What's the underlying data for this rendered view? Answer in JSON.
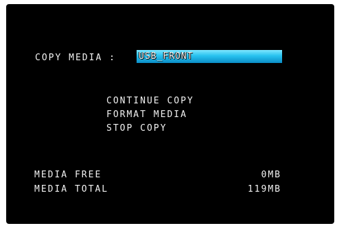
{
  "copy_media": {
    "label": "COPY MEDIA :",
    "value": "USB_FRONT"
  },
  "menu": {
    "items": [
      {
        "label": "CONTINUE COPY"
      },
      {
        "label": "FORMAT MEDIA"
      },
      {
        "label": "STOP COPY"
      }
    ]
  },
  "stats": {
    "media_free": {
      "label": "MEDIA FREE",
      "value": "0MB"
    },
    "media_total": {
      "label": "MEDIA TOTAL",
      "value": "119MB"
    }
  },
  "colors": {
    "background": "#000000",
    "text": "#f2f2f2",
    "highlight": "#27c2ef"
  }
}
